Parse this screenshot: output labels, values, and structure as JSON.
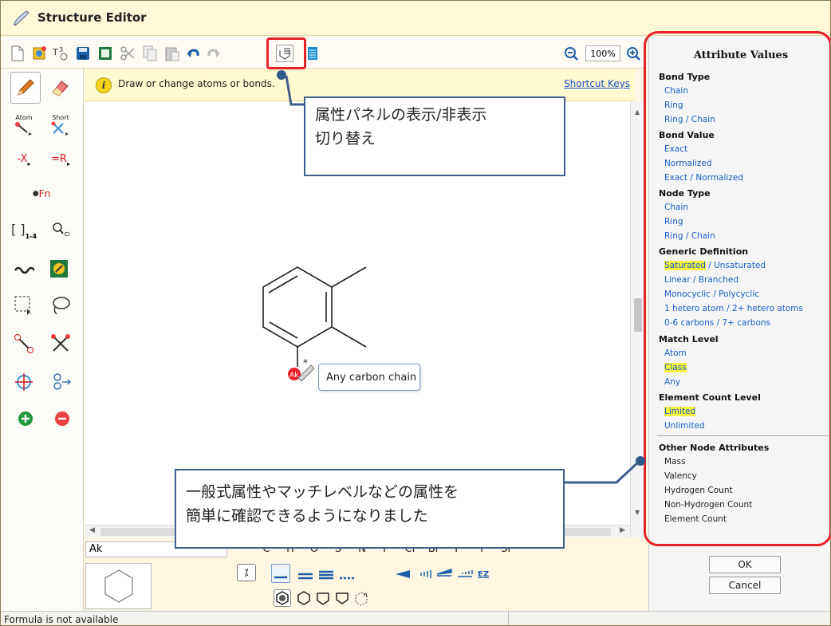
{
  "window": {
    "title": "Structure Editor"
  },
  "toolbar": {
    "zoom_value": "100%",
    "icons": [
      "new-icon",
      "template-icon",
      "text-icon",
      "save-icon",
      "frame-icon",
      "cut-icon",
      "copy-icon",
      "paste-icon",
      "undo-icon",
      "redo-icon",
      "attribute-panel-toggle-icon",
      "list-icon",
      "zoom-out-icon",
      "zoom-in-icon"
    ]
  },
  "left_tools": {
    "atom_label": "Atom",
    "short_label": "Short",
    "minus_x": "-X",
    "equals_r": "=R",
    "fn_label": "Fn",
    "bracket_sub": "1-4",
    "query_sub": "Cl"
  },
  "hint": {
    "text": "Draw or change atoms or bonds.",
    "shortcut_label": "Shortcut Keys"
  },
  "canvas": {
    "atom_label": "Ak",
    "atom_color": "#e8202a",
    "tooltip": "Any carbon chain"
  },
  "bottom": {
    "name_input_value": "Ak",
    "elements": [
      "C",
      "H",
      "O",
      "S",
      "N",
      "P",
      "Cl",
      "Br",
      "F",
      "I",
      "Si"
    ],
    "ez_label": "EZ"
  },
  "attribute_panel": {
    "title": "Attribute Values",
    "sections": [
      {
        "title": "Bond Type",
        "options": [
          {
            "parts": [
              {
                "text": "Chain",
                "hl": false
              }
            ]
          },
          {
            "parts": [
              {
                "text": "Ring",
                "hl": false
              }
            ]
          },
          {
            "parts": [
              {
                "text": "Ring / Chain",
                "hl": false
              }
            ]
          }
        ]
      },
      {
        "title": "Bond Value",
        "options": [
          {
            "parts": [
              {
                "text": "Exact",
                "hl": false
              }
            ]
          },
          {
            "parts": [
              {
                "text": "Normalized",
                "hl": false
              }
            ]
          },
          {
            "parts": [
              {
                "text": "Exact / Normalized",
                "hl": false
              }
            ]
          }
        ]
      },
      {
        "title": "Node Type",
        "options": [
          {
            "parts": [
              {
                "text": "Chain",
                "hl": false
              }
            ]
          },
          {
            "parts": [
              {
                "text": "Ring",
                "hl": false
              }
            ]
          },
          {
            "parts": [
              {
                "text": "Ring / Chain",
                "hl": false
              }
            ]
          }
        ]
      },
      {
        "title": "Generic Definition",
        "options": [
          {
            "parts": [
              {
                "text": "Saturated",
                "hl": true
              },
              {
                "text": " / Unsaturated",
                "hl": false
              }
            ]
          },
          {
            "parts": [
              {
                "text": "Linear / Branched",
                "hl": false
              }
            ]
          },
          {
            "parts": [
              {
                "text": "Monocyclic / Polycyclic",
                "hl": false
              }
            ]
          },
          {
            "parts": [
              {
                "text": "1 hetero atom / 2+ hetero atoms",
                "hl": false
              }
            ]
          },
          {
            "parts": [
              {
                "text": "0-6 carbons / 7+ carbons",
                "hl": false
              }
            ]
          }
        ]
      },
      {
        "title": "Match Level",
        "options": [
          {
            "parts": [
              {
                "text": "Atom",
                "hl": false
              }
            ]
          },
          {
            "parts": [
              {
                "text": "Class",
                "hl": true
              }
            ]
          },
          {
            "parts": [
              {
                "text": "Any",
                "hl": false
              }
            ]
          }
        ]
      },
      {
        "title": "Element Count Level",
        "options": [
          {
            "parts": [
              {
                "text": "Limited",
                "hl": true
              }
            ]
          },
          {
            "parts": [
              {
                "text": "Unlimited",
                "hl": false
              }
            ]
          }
        ]
      }
    ],
    "other_title": "Other Node Attributes",
    "other_items": [
      "Mass",
      "Valency",
      "Hydrogen Count",
      "Non-Hydrogen Count",
      "Element Count"
    ],
    "ok_label": "OK",
    "cancel_label": "Cancel"
  },
  "status": {
    "text": "Formula is not available"
  },
  "callouts": {
    "top_line1": "属性パネルの表示/非表示",
    "top_line2": "切り替え",
    "bottom_line1": "一般式属性やマッチレベルなどの属性を",
    "bottom_line2": "簡単に確認できるようになりました"
  },
  "colors": {
    "highlight": "#f7f23d",
    "link_blue": "#1a5fc8",
    "callout_border": "#3f5f8c",
    "red_annotation": "#e8202a"
  }
}
